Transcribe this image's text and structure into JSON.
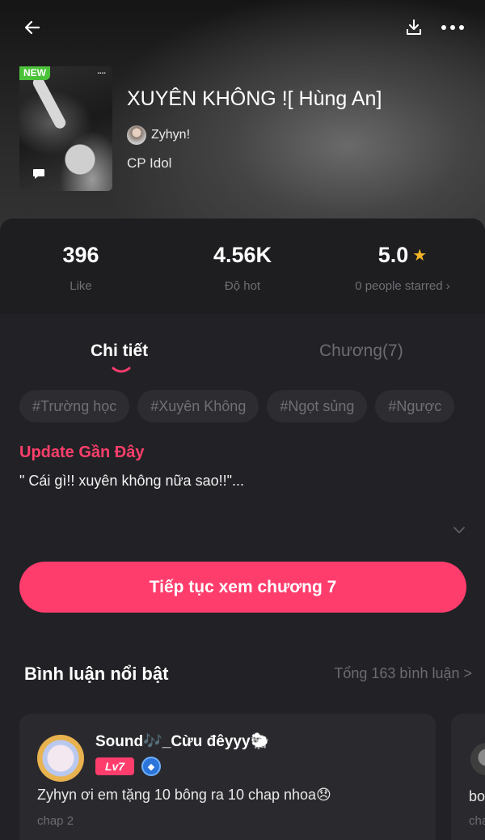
{
  "header": {
    "cover_badge": "NEW",
    "title": "XUYÊN KHÔNG ![ Hùng An]",
    "author": "Zyhyn!",
    "genre": "CP Idol"
  },
  "stats": {
    "likes": {
      "value": "396",
      "label": "Like"
    },
    "hot": {
      "value": "4.56K",
      "label": "Độ hot"
    },
    "rating": {
      "value": "5.0",
      "label": "0 people starred ›"
    }
  },
  "tabs": [
    {
      "label": "Chi tiết",
      "active": true
    },
    {
      "label": "Chương(7)",
      "active": false
    }
  ],
  "tags": [
    "#Trường học",
    "#Xuyên Không",
    "#Ngọt sủng",
    "#Ngược"
  ],
  "update": {
    "title": "Update Gần Đây",
    "text": "\" Cái gì!! xuyên không nữa sao!!\"..."
  },
  "cta_label": "Tiếp tục xem chương 7",
  "comments": {
    "heading": "Bình luận nổi bật",
    "total": "Tổng 163 bình luận >",
    "items": [
      {
        "name": "Sound🎶_Cừu đêyyy🐑",
        "level": "Lv7",
        "text": "Zyhyn ơi em tặng 10 bông ra 10 chap nhoa😞",
        "chapter": "chap 2"
      },
      {
        "text": "bo",
        "chapter": "cha"
      }
    ]
  },
  "colors": {
    "accent": "#ff3d6d",
    "new_badge": "#4cc23a",
    "star": "#f2b627"
  },
  "icons": [
    "back-arrow-icon",
    "download-icon",
    "more-icon",
    "chat-bubble-icon",
    "star-icon",
    "chevron-down-icon",
    "verified-icon"
  ]
}
